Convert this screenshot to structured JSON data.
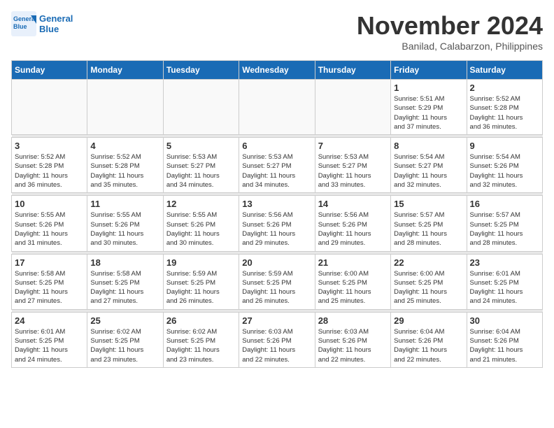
{
  "header": {
    "logo_line1": "General",
    "logo_line2": "Blue",
    "month": "November 2024",
    "location": "Banilad, Calabarzon, Philippines"
  },
  "weekdays": [
    "Sunday",
    "Monday",
    "Tuesday",
    "Wednesday",
    "Thursday",
    "Friday",
    "Saturday"
  ],
  "weeks": [
    [
      {
        "day": "",
        "info": ""
      },
      {
        "day": "",
        "info": ""
      },
      {
        "day": "",
        "info": ""
      },
      {
        "day": "",
        "info": ""
      },
      {
        "day": "",
        "info": ""
      },
      {
        "day": "1",
        "info": "Sunrise: 5:51 AM\nSunset: 5:29 PM\nDaylight: 11 hours\nand 37 minutes."
      },
      {
        "day": "2",
        "info": "Sunrise: 5:52 AM\nSunset: 5:28 PM\nDaylight: 11 hours\nand 36 minutes."
      }
    ],
    [
      {
        "day": "3",
        "info": "Sunrise: 5:52 AM\nSunset: 5:28 PM\nDaylight: 11 hours\nand 36 minutes."
      },
      {
        "day": "4",
        "info": "Sunrise: 5:52 AM\nSunset: 5:28 PM\nDaylight: 11 hours\nand 35 minutes."
      },
      {
        "day": "5",
        "info": "Sunrise: 5:53 AM\nSunset: 5:27 PM\nDaylight: 11 hours\nand 34 minutes."
      },
      {
        "day": "6",
        "info": "Sunrise: 5:53 AM\nSunset: 5:27 PM\nDaylight: 11 hours\nand 34 minutes."
      },
      {
        "day": "7",
        "info": "Sunrise: 5:53 AM\nSunset: 5:27 PM\nDaylight: 11 hours\nand 33 minutes."
      },
      {
        "day": "8",
        "info": "Sunrise: 5:54 AM\nSunset: 5:27 PM\nDaylight: 11 hours\nand 32 minutes."
      },
      {
        "day": "9",
        "info": "Sunrise: 5:54 AM\nSunset: 5:26 PM\nDaylight: 11 hours\nand 32 minutes."
      }
    ],
    [
      {
        "day": "10",
        "info": "Sunrise: 5:55 AM\nSunset: 5:26 PM\nDaylight: 11 hours\nand 31 minutes."
      },
      {
        "day": "11",
        "info": "Sunrise: 5:55 AM\nSunset: 5:26 PM\nDaylight: 11 hours\nand 30 minutes."
      },
      {
        "day": "12",
        "info": "Sunrise: 5:55 AM\nSunset: 5:26 PM\nDaylight: 11 hours\nand 30 minutes."
      },
      {
        "day": "13",
        "info": "Sunrise: 5:56 AM\nSunset: 5:26 PM\nDaylight: 11 hours\nand 29 minutes."
      },
      {
        "day": "14",
        "info": "Sunrise: 5:56 AM\nSunset: 5:26 PM\nDaylight: 11 hours\nand 29 minutes."
      },
      {
        "day": "15",
        "info": "Sunrise: 5:57 AM\nSunset: 5:25 PM\nDaylight: 11 hours\nand 28 minutes."
      },
      {
        "day": "16",
        "info": "Sunrise: 5:57 AM\nSunset: 5:25 PM\nDaylight: 11 hours\nand 28 minutes."
      }
    ],
    [
      {
        "day": "17",
        "info": "Sunrise: 5:58 AM\nSunset: 5:25 PM\nDaylight: 11 hours\nand 27 minutes."
      },
      {
        "day": "18",
        "info": "Sunrise: 5:58 AM\nSunset: 5:25 PM\nDaylight: 11 hours\nand 27 minutes."
      },
      {
        "day": "19",
        "info": "Sunrise: 5:59 AM\nSunset: 5:25 PM\nDaylight: 11 hours\nand 26 minutes."
      },
      {
        "day": "20",
        "info": "Sunrise: 5:59 AM\nSunset: 5:25 PM\nDaylight: 11 hours\nand 26 minutes."
      },
      {
        "day": "21",
        "info": "Sunrise: 6:00 AM\nSunset: 5:25 PM\nDaylight: 11 hours\nand 25 minutes."
      },
      {
        "day": "22",
        "info": "Sunrise: 6:00 AM\nSunset: 5:25 PM\nDaylight: 11 hours\nand 25 minutes."
      },
      {
        "day": "23",
        "info": "Sunrise: 6:01 AM\nSunset: 5:25 PM\nDaylight: 11 hours\nand 24 minutes."
      }
    ],
    [
      {
        "day": "24",
        "info": "Sunrise: 6:01 AM\nSunset: 5:25 PM\nDaylight: 11 hours\nand 24 minutes."
      },
      {
        "day": "25",
        "info": "Sunrise: 6:02 AM\nSunset: 5:25 PM\nDaylight: 11 hours\nand 23 minutes."
      },
      {
        "day": "26",
        "info": "Sunrise: 6:02 AM\nSunset: 5:25 PM\nDaylight: 11 hours\nand 23 minutes."
      },
      {
        "day": "27",
        "info": "Sunrise: 6:03 AM\nSunset: 5:26 PM\nDaylight: 11 hours\nand 22 minutes."
      },
      {
        "day": "28",
        "info": "Sunrise: 6:03 AM\nSunset: 5:26 PM\nDaylight: 11 hours\nand 22 minutes."
      },
      {
        "day": "29",
        "info": "Sunrise: 6:04 AM\nSunset: 5:26 PM\nDaylight: 11 hours\nand 22 minutes."
      },
      {
        "day": "30",
        "info": "Sunrise: 6:04 AM\nSunset: 5:26 PM\nDaylight: 11 hours\nand 21 minutes."
      }
    ]
  ]
}
